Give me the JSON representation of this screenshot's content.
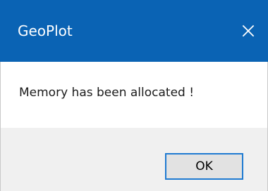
{
  "window": {
    "title": "GeoPlot",
    "close_icon": "close-icon",
    "title_bar_color": "#0a63b4"
  },
  "dialog": {
    "message": "Memory has been allocated !"
  },
  "buttons": {
    "ok_label": "OK",
    "ok_border_color": "#1e7ad1"
  }
}
